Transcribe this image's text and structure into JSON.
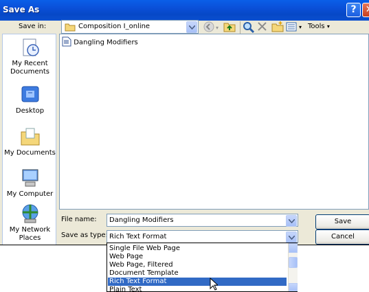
{
  "window": {
    "title": "Save As",
    "help_glyph": "?",
    "close_glyph": "✕"
  },
  "toolbar": {
    "save_in_label": "Save in:",
    "save_in_value": "Composition I_online",
    "tools_label": "Tools"
  },
  "places": [
    {
      "label_line1": "My Recent",
      "label_line2": "Documents",
      "icon": "recent-documents-icon"
    },
    {
      "label_line1": "Desktop",
      "label_line2": "",
      "icon": "desktop-icon"
    },
    {
      "label_line1": "My Documents",
      "label_line2": "",
      "icon": "my-documents-icon"
    },
    {
      "label_line1": "My Computer",
      "label_line2": "",
      "icon": "my-computer-icon"
    },
    {
      "label_line1": "My Network",
      "label_line2": "Places",
      "icon": "network-places-icon"
    }
  ],
  "files": [
    {
      "name": "Dangling Modifiers",
      "icon": "rtf-document-icon"
    }
  ],
  "form": {
    "file_name_label": "File name:",
    "file_name_value": "Dangling Modifiers",
    "save_as_type_label": "Save as type:",
    "save_as_type_value": "Rich Text Format",
    "save_button": "Save",
    "cancel_button": "Cancel"
  },
  "type_options": [
    {
      "label": "Single File Web Page",
      "selected": false
    },
    {
      "label": "Web Page",
      "selected": false
    },
    {
      "label": "Web Page, Filtered",
      "selected": false
    },
    {
      "label": "Document Template",
      "selected": false
    },
    {
      "label": "Rich Text Format",
      "selected": true
    },
    {
      "label": "Plain Text",
      "selected": false
    }
  ],
  "colors": {
    "titlebar": "#0a4fd8",
    "dialog_bg": "#ece9d8",
    "selection": "#316ac5",
    "input_border": "#7f9db9"
  }
}
